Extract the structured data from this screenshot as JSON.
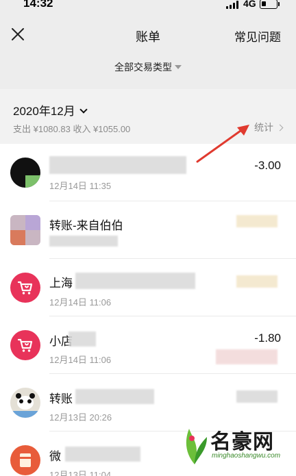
{
  "status_bar": {
    "time": "14:32",
    "network": "4G"
  },
  "nav": {
    "title": "账单",
    "faq": "常见问题"
  },
  "filter": {
    "label": "全部交易类型"
  },
  "summary": {
    "month": "2020年12月",
    "totals": "支出 ¥1080.83 收入 ¥1055.00",
    "stats_label": "统计"
  },
  "transactions": [
    {
      "title": "",
      "time": "12月14日 11:35",
      "amount": "-3.00"
    },
    {
      "title": "转账-来自伯伯",
      "time": "",
      "amount": ""
    },
    {
      "title": "上海",
      "time": "12月14日 11:06",
      "amount": ""
    },
    {
      "title": "小店",
      "time": "12月14日 11:06",
      "amount": "-1.80"
    },
    {
      "title": "转账",
      "time": "12月13日 20:26",
      "amount": ""
    },
    {
      "title": "微",
      "time": "12月13日 11:04",
      "amount": ""
    }
  ],
  "watermark": {
    "name": "名豪网",
    "url": "minghaoshangwu.com"
  },
  "colors": {
    "accent_pink": "#e8335a",
    "arrow_red": "#e03a2f"
  }
}
